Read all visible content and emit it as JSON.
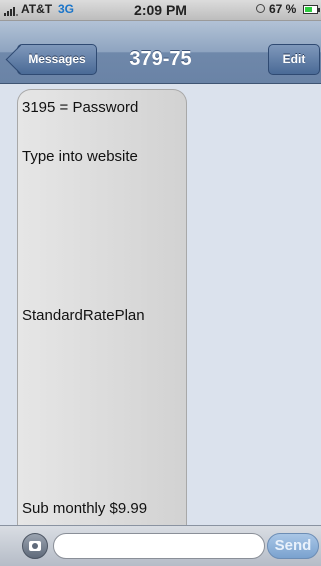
{
  "status_bar": {
    "carrier": "AT&T",
    "network": "3G",
    "time": "2:09 PM",
    "battery_percent": "67 %",
    "battery_level": 0.67,
    "icons": [
      "signal-icon",
      "alarm-icon",
      "battery-icon"
    ]
  },
  "nav": {
    "back_label": "Messages",
    "title": "379-75",
    "edit_label": "Edit"
  },
  "conversation": {
    "message_lines": [
      "3195 = Password",
      "Type into website",
      "StandardRatePlan",
      "Sub monthly $9.99"
    ]
  },
  "composer": {
    "input_value": "",
    "send_label": "Send"
  },
  "colors": {
    "nav_bar": "#8ea4c0",
    "bubble": "#dcdcdc",
    "background": "#dbe2ed",
    "network_text": "#1b75c9",
    "battery_fill": "#2ecc40"
  }
}
